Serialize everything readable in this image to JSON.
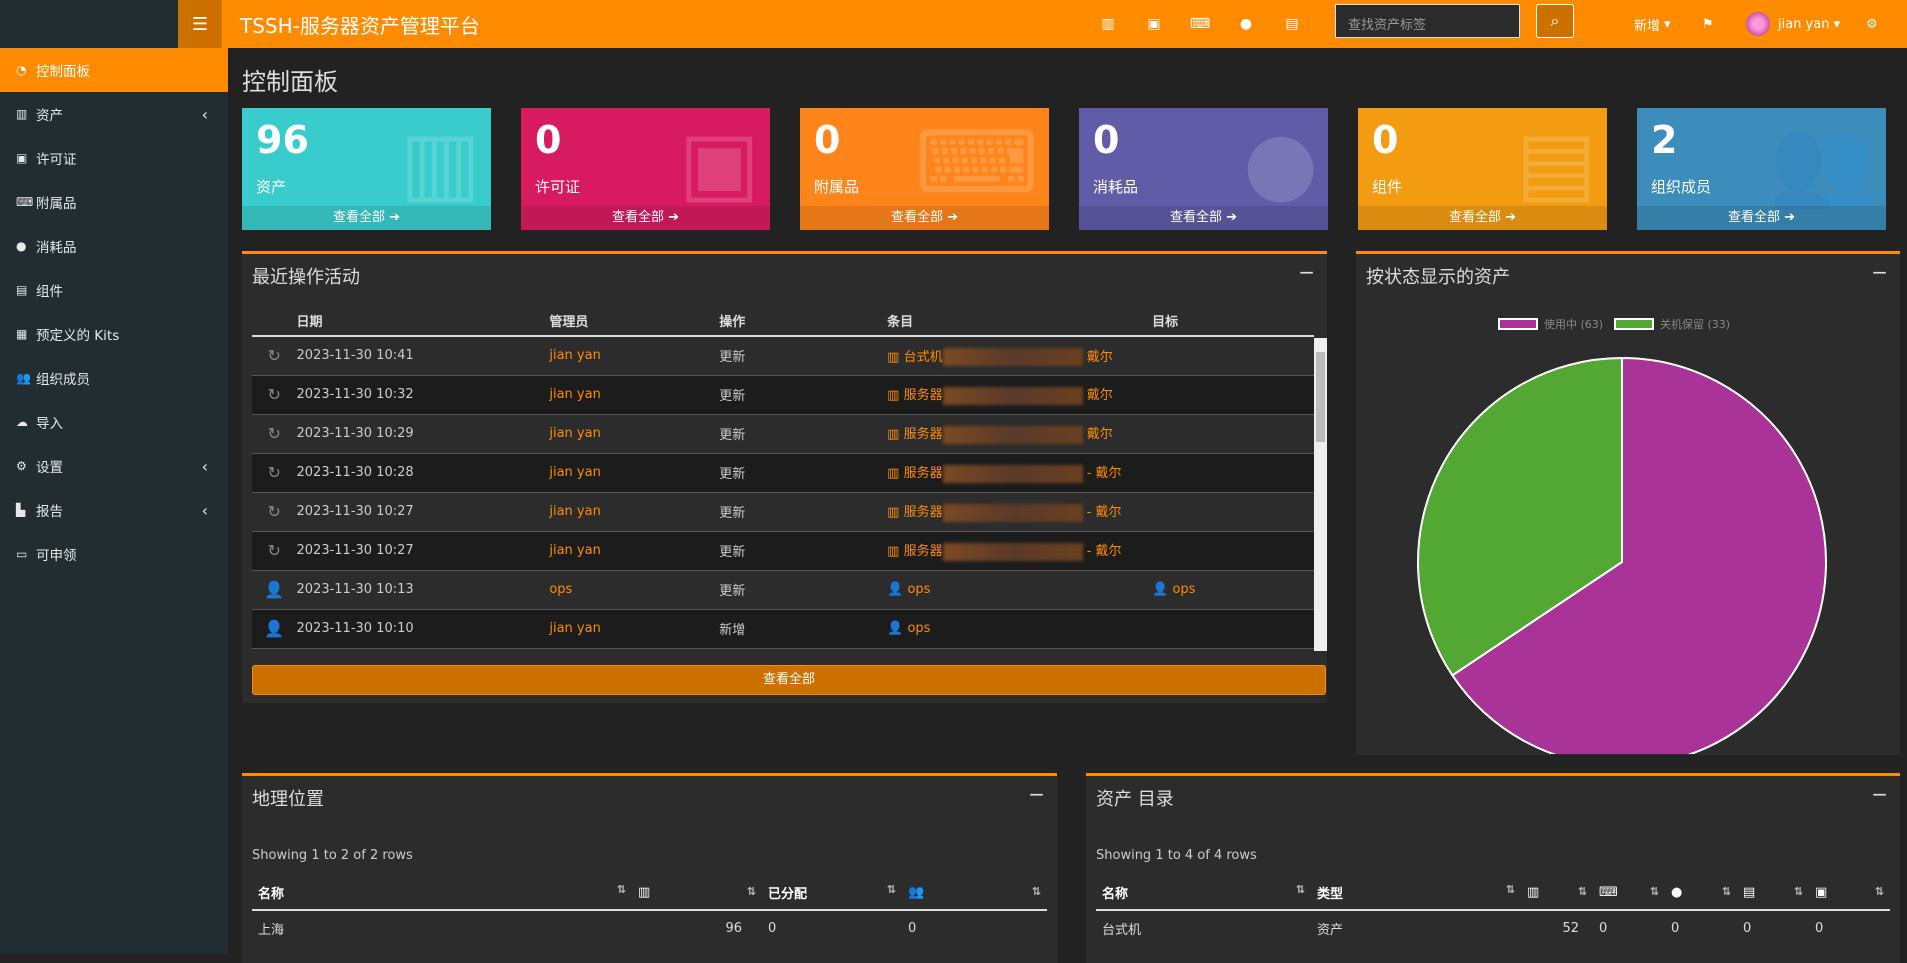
{
  "app": {
    "title": "TSSH-服务器资产管理平台",
    "menu_icon": "hamburger-icon"
  },
  "topbar": {
    "icons": [
      "barcode-icon",
      "floppy-icon",
      "keyboard-icon",
      "drop-icon",
      "hdd-icon"
    ],
    "search_placeholder": "查找资产标签",
    "new_label": "新增",
    "user_name": "jian yan"
  },
  "sidebar": {
    "items": [
      {
        "label": "控制面板",
        "icon": "dashboard-icon",
        "active": true
      },
      {
        "label": "资产",
        "icon": "barcode-icon",
        "chevron": true
      },
      {
        "label": "许可证",
        "icon": "floppy-icon"
      },
      {
        "label": "附属品",
        "icon": "keyboard-icon"
      },
      {
        "label": "消耗品",
        "icon": "drop-icon"
      },
      {
        "label": "组件",
        "icon": "hdd-icon"
      },
      {
        "label": "预定义的 Kits",
        "icon": "kits-icon"
      },
      {
        "label": "组织成员",
        "icon": "users-icon"
      },
      {
        "label": "导入",
        "icon": "cloud-upload-icon"
      },
      {
        "label": "设置",
        "icon": "gear-icon",
        "chevron": true
      },
      {
        "label": "报告",
        "icon": "chart-icon",
        "chevron": true
      },
      {
        "label": "可申领",
        "icon": "laptop-icon"
      }
    ]
  },
  "page_title": "控制面板",
  "boxes": [
    {
      "num": "96",
      "label": "资产",
      "link": "查看全部",
      "color": "#39cccc",
      "icon": "barcode-icon"
    },
    {
      "num": "0",
      "label": "许可证",
      "link": "查看全部",
      "color": "#d81b60",
      "icon": "floppy-icon"
    },
    {
      "num": "0",
      "label": "附属品",
      "link": "查看全部",
      "color": "#ff851b",
      "icon": "keyboard-icon"
    },
    {
      "num": "0",
      "label": "消耗品",
      "link": "查看全部",
      "color": "#605ca8",
      "icon": "drop-icon"
    },
    {
      "num": "0",
      "label": "组件",
      "link": "查看全部",
      "color": "#f39c12",
      "icon": "hdd-icon"
    },
    {
      "num": "2",
      "label": "组织成员",
      "link": "查看全部",
      "color": "#3c8dbc",
      "icon": "users-icon"
    }
  ],
  "activity": {
    "title": "最近操作活动",
    "headers": [
      "日期",
      "管理员",
      "操作",
      "条目",
      "目标"
    ],
    "view_all": "查看全部",
    "rows": [
      {
        "icon": "refresh-icon",
        "date": "2023-11-30 10:41",
        "admin": "jian yan",
        "action": "更新",
        "item_pre": "台式机",
        "item_post": "戴尔",
        "target": ""
      },
      {
        "icon": "refresh-icon",
        "date": "2023-11-30 10:32",
        "admin": "jian yan",
        "action": "更新",
        "item_pre": "服务器",
        "item_post": "戴尔",
        "target": ""
      },
      {
        "icon": "refresh-icon",
        "date": "2023-11-30 10:29",
        "admin": "jian yan",
        "action": "更新",
        "item_pre": "服务器",
        "item_post": "戴尔",
        "target": ""
      },
      {
        "icon": "refresh-icon",
        "date": "2023-11-30 10:28",
        "admin": "jian yan",
        "action": "更新",
        "item_pre": "服务器",
        "item_post": "- 戴尔",
        "target": ""
      },
      {
        "icon": "refresh-icon",
        "date": "2023-11-30 10:27",
        "admin": "jian yan",
        "action": "更新",
        "item_pre": "服务器",
        "item_post": "- 戴尔",
        "target": ""
      },
      {
        "icon": "refresh-icon",
        "date": "2023-11-30 10:27",
        "admin": "jian yan",
        "action": "更新",
        "item_pre": "服务器",
        "item_post": "- 戴尔",
        "target": ""
      },
      {
        "icon": "user-icon",
        "date": "2023-11-30 10:13",
        "admin": "ops",
        "action": "更新",
        "item_pre": "ops",
        "item_post": "",
        "target": "ops"
      },
      {
        "icon": "user-icon",
        "date": "2023-11-30 10:10",
        "admin": "jian yan",
        "action": "新增",
        "item_pre": "ops",
        "item_post": "",
        "target": ""
      }
    ]
  },
  "status_panel": {
    "title": "按状态显示的资产"
  },
  "chart_data": {
    "type": "pie",
    "series": [
      {
        "name": "使用中 (63)",
        "value": 63,
        "color": "#a93396"
      },
      {
        "name": "关机保留 (33)",
        "value": 33,
        "color": "#52a832"
      }
    ],
    "legend": "top"
  },
  "locations": {
    "title": "地理位置",
    "showing": "Showing 1 to 2 of 2 rows",
    "headers": [
      "名称",
      "",
      "已分配",
      ""
    ],
    "rows": [
      {
        "name": "上海",
        "assets": "96",
        "assigned": "0",
        "users": "0"
      }
    ]
  },
  "categories": {
    "title": "资产 目录",
    "showing": "Showing 1 to 4 of 4 rows",
    "headers": [
      "名称",
      "类型"
    ],
    "rows": [
      {
        "name": "台式机",
        "type": "资产",
        "c1": "52",
        "c2": "0",
        "c3": "0",
        "c4": "0",
        "c5": "0"
      }
    ]
  }
}
